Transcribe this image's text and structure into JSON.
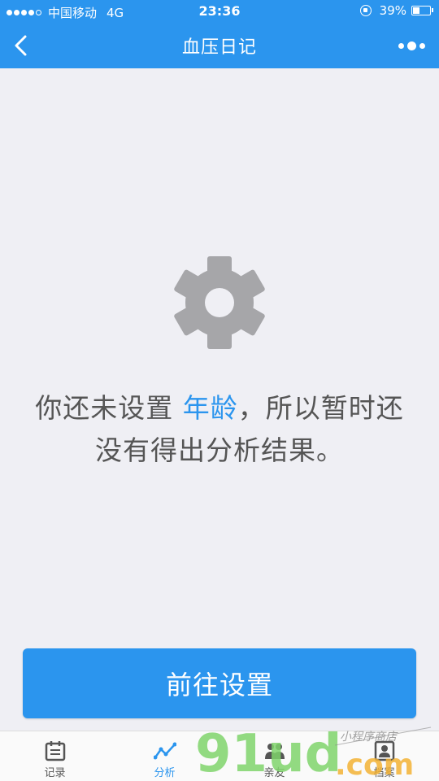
{
  "status_bar": {
    "carrier": "中国移动",
    "network": "4G",
    "time": "23:36",
    "battery": "39%"
  },
  "nav": {
    "title": "血压日记"
  },
  "empty_state": {
    "message_before": "你还未设置 ",
    "message_highlight": "年龄",
    "message_after": "，所以暂时还没有得出分析结果。"
  },
  "action": {
    "button_label": "前往设置"
  },
  "tabs": [
    {
      "label": "记录",
      "icon": "calendar-icon"
    },
    {
      "label": "分析",
      "icon": "trend-line-icon",
      "active": true
    },
    {
      "label": "亲友",
      "icon": "people-icon"
    },
    {
      "label": "档案",
      "icon": "profile-icon"
    }
  ],
  "watermark": {
    "text": "91ud.com",
    "subtitle": "小程序商店"
  },
  "colors": {
    "primary": "#2b95ee",
    "background": "#efeff4",
    "text": "#555555",
    "icon_gray": "#a6a6a9"
  }
}
